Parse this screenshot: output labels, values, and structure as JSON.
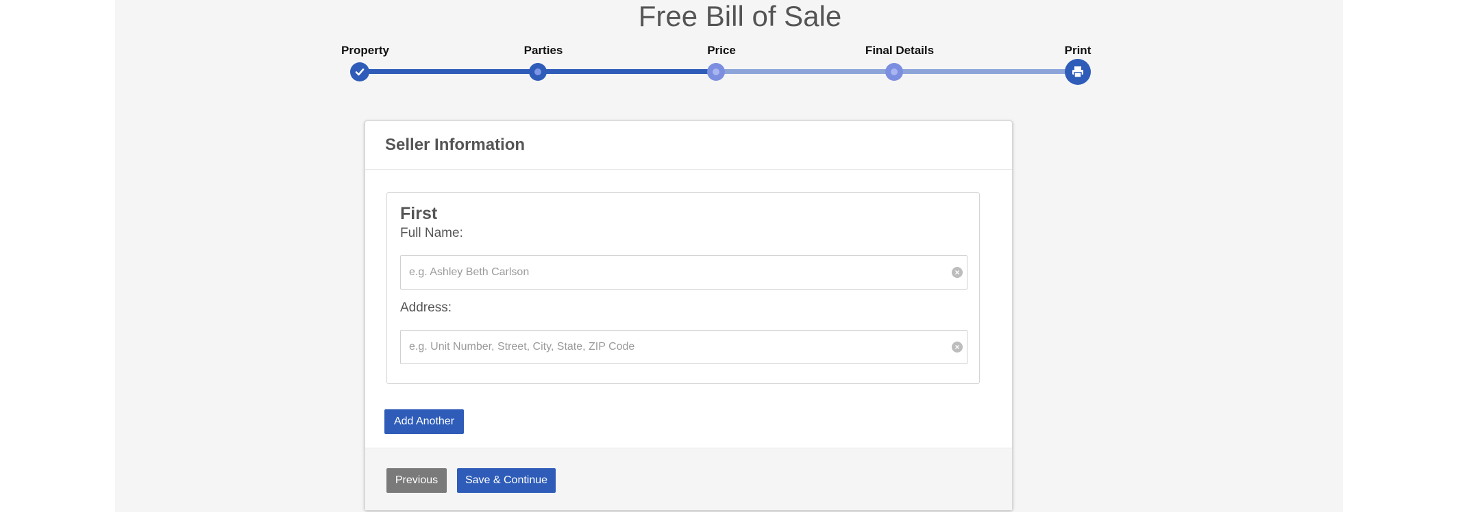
{
  "page": {
    "title": "Free Bill of Sale"
  },
  "stepper": {
    "steps": [
      {
        "label": "Property",
        "state": "completed"
      },
      {
        "label": "Parties",
        "state": "current"
      },
      {
        "label": "Price",
        "state": "upcoming"
      },
      {
        "label": "Final Details",
        "state": "upcoming"
      },
      {
        "label": "Print",
        "state": "final"
      }
    ],
    "icons": {
      "completed": "check-icon",
      "final": "printer-icon"
    }
  },
  "card": {
    "title": "Seller Information",
    "party": {
      "heading": "First",
      "full_name": {
        "label": "Full Name:",
        "value": "",
        "placeholder": "e.g. Ashley Beth Carlson"
      },
      "address": {
        "label": "Address:",
        "value": "",
        "placeholder": "e.g. Unit Number, Street, City, State, ZIP Code"
      }
    },
    "add_another_label": "Add Another",
    "previous_label": "Previous",
    "save_continue_label": "Save & Continue"
  },
  "colors": {
    "accent": "#2e5cb8",
    "accent_light": "#8ca4d8",
    "secondary_button": "#7a7a7a",
    "page_background": "#f5f5f5"
  }
}
